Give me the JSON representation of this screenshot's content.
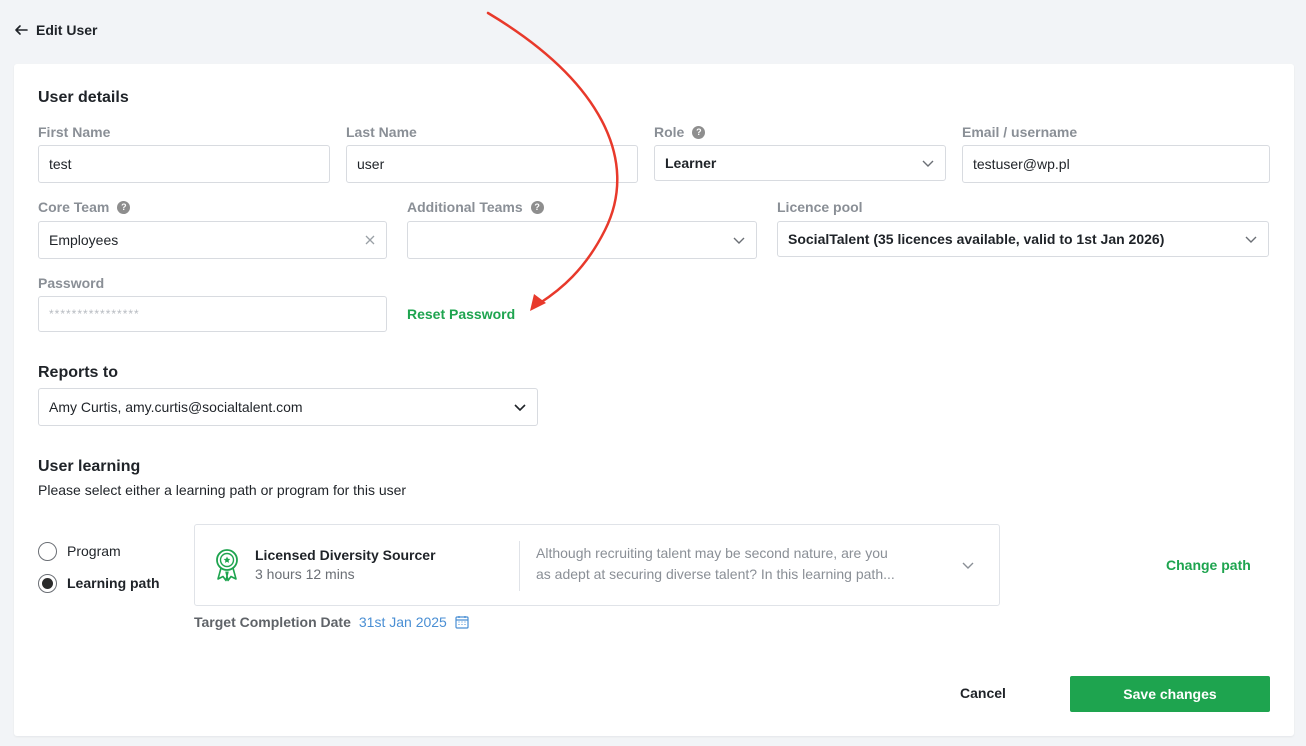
{
  "header": {
    "back_label": "Edit User"
  },
  "user_details": {
    "title": "User details",
    "first_name": {
      "label": "First Name",
      "value": "test"
    },
    "last_name": {
      "label": "Last Name",
      "value": "user"
    },
    "role": {
      "label": "Role",
      "help": "?",
      "value": "Learner"
    },
    "email": {
      "label": "Email / username",
      "value": "testuser@wp.pl"
    },
    "core_team": {
      "label": "Core Team",
      "help": "?",
      "value": "Employees"
    },
    "additional_teams": {
      "label": "Additional Teams",
      "help": "?",
      "value": ""
    },
    "licence_pool": {
      "label": "Licence pool",
      "value": "SocialTalent (35 licences available, valid to 1st Jan 2026)"
    },
    "password": {
      "label": "Password",
      "value": "****************"
    },
    "reset_password": "Reset Password"
  },
  "reports_to": {
    "title": "Reports to",
    "value": "Amy Curtis, amy.curtis@socialtalent.com"
  },
  "user_learning": {
    "title": "User learning",
    "subtitle": "Please select either a learning path or program for this user",
    "options": [
      {
        "label": "Program",
        "selected": false
      },
      {
        "label": "Learning path",
        "selected": true
      }
    ],
    "path": {
      "title": "Licensed Diversity Sourcer",
      "duration": "3 hours 12 mins",
      "description_line1": "Although recruiting talent may be second nature, are you",
      "description_line2": "as adept at securing diverse talent? In this learning path..."
    },
    "change_path": "Change path",
    "target_label": "Target Completion Date",
    "target_date": "31st Jan 2025"
  },
  "actions": {
    "cancel": "Cancel",
    "save": "Save changes"
  },
  "colors": {
    "accent": "#1ea44f",
    "annotation_arrow": "#e8392b",
    "date_link": "#4a8fd4"
  }
}
